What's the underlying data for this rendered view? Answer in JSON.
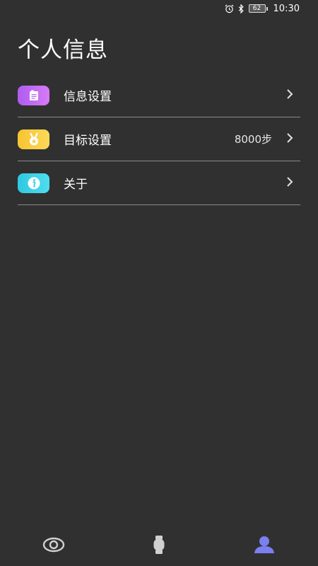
{
  "status_bar": {
    "battery": "62",
    "time": "10:30"
  },
  "page": {
    "title": "个人信息"
  },
  "menu": {
    "items": [
      {
        "label": "信息设置",
        "value": "",
        "icon": "profile-card-icon",
        "color": "#c26cf5"
      },
      {
        "label": "目标设置",
        "value": "8000步",
        "icon": "medal-icon",
        "color": "#fbcf45"
      },
      {
        "label": "关于",
        "value": "",
        "icon": "info-icon",
        "color": "#3fd3e8"
      }
    ]
  },
  "bottom_nav": {
    "tabs": [
      {
        "icon": "eye-icon",
        "active": false
      },
      {
        "icon": "watch-icon",
        "active": false
      },
      {
        "icon": "person-icon",
        "active": true
      }
    ],
    "active_color": "#7b7ff0",
    "inactive_color": "#d0d0d0"
  }
}
